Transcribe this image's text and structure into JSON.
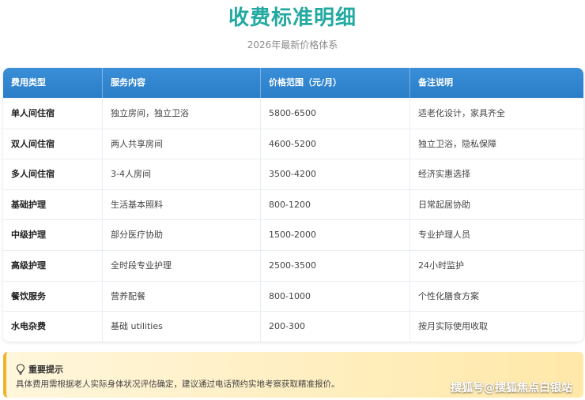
{
  "header": {
    "title": "收费标准明细",
    "subtitle": "2026年最新价格体系"
  },
  "table": {
    "headers": [
      "费用类型",
      "服务内容",
      "价格范围（元/月）",
      "备注说明"
    ],
    "rows": [
      [
        "单人间住宿",
        "独立房间，独立卫浴",
        "5800-6500",
        "适老化设计，家具齐全"
      ],
      [
        "双人间住宿",
        "两人共享房间",
        "4600-5200",
        "独立卫浴，隐私保障"
      ],
      [
        "多人间住宿",
        "3-4人房间",
        "3500-4200",
        "经济实惠选择"
      ],
      [
        "基础护理",
        "生活基本照料",
        "800-1200",
        "日常起居协助"
      ],
      [
        "中级护理",
        "部分医疗协助",
        "1500-2000",
        "专业护理人员"
      ],
      [
        "高级护理",
        "全时段专业护理",
        "2500-3500",
        "24小时监护"
      ],
      [
        "餐饮服务",
        "营养配餐",
        "800-1000",
        "个性化膳食方案"
      ],
      [
        "水电杂费",
        "基础 utilities",
        "200-300",
        "按月实际使用收取"
      ]
    ]
  },
  "notice": {
    "icon": "lightbulb-icon",
    "title": "重要提示",
    "text": "具体费用需根据老人实际身体状况评估确定，建议通过电话预约实地考察获取精准报价。"
  },
  "watermark": "搜狐号@搜狐焦点白银站",
  "colors": {
    "title": "#22a9a0",
    "header_bg": "#2a7dc7",
    "notice_border": "#f0b429",
    "notice_bg": "#ffe8a8"
  }
}
